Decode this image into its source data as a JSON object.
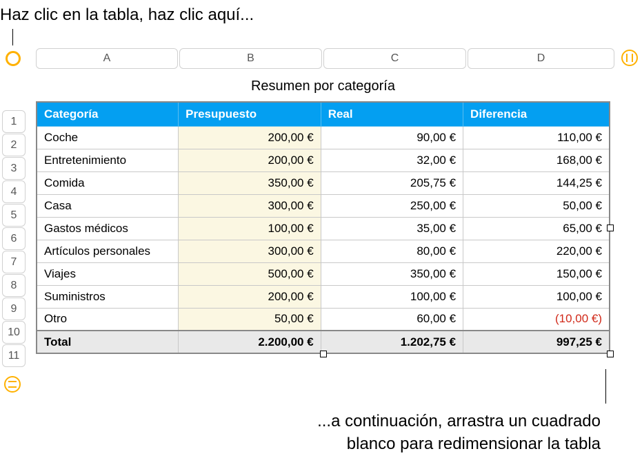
{
  "callouts": {
    "top": "Haz clic en la tabla, haz clic aquí...",
    "bottom_line1": "...a continuación, arrastra un cuadrado",
    "bottom_line2": "blanco para redimensionar la tabla"
  },
  "columns": [
    "A",
    "B",
    "C",
    "D"
  ],
  "row_numbers": [
    "1",
    "2",
    "3",
    "4",
    "5",
    "6",
    "7",
    "8",
    "9",
    "10",
    "11"
  ],
  "table": {
    "title": "Resumen por categoría",
    "headers": {
      "category": "Categoría",
      "budget": "Presupuesto",
      "actual": "Real",
      "diff": "Diferencia"
    },
    "rows": [
      {
        "category": "Coche",
        "budget": "200,00 €",
        "actual": "90,00 €",
        "diff": "110,00 €",
        "neg": false
      },
      {
        "category": "Entretenimiento",
        "budget": "200,00 €",
        "actual": "32,00 €",
        "diff": "168,00 €",
        "neg": false
      },
      {
        "category": "Comida",
        "budget": "350,00 €",
        "actual": "205,75 €",
        "diff": "144,25 €",
        "neg": false
      },
      {
        "category": "Casa",
        "budget": "300,00 €",
        "actual": "250,00 €",
        "diff": "50,00 €",
        "neg": false
      },
      {
        "category": "Gastos médicos",
        "budget": "100,00 €",
        "actual": "35,00 €",
        "diff": "65,00 €",
        "neg": false
      },
      {
        "category": "Artículos personales",
        "budget": "300,00 €",
        "actual": "80,00 €",
        "diff": "220,00 €",
        "neg": false
      },
      {
        "category": "Viajes",
        "budget": "500,00 €",
        "actual": "350,00 €",
        "diff": "150,00 €",
        "neg": false
      },
      {
        "category": "Suministros",
        "budget": "200,00 €",
        "actual": "100,00 €",
        "diff": "100,00 €",
        "neg": false
      },
      {
        "category": "Otro",
        "budget": "50,00 €",
        "actual": "60,00 €",
        "diff": "(10,00 €)",
        "neg": true
      }
    ],
    "total": {
      "label": "Total",
      "budget": "2.200,00 €",
      "actual": "1.202,75 €",
      "diff": "997,25 €"
    }
  }
}
